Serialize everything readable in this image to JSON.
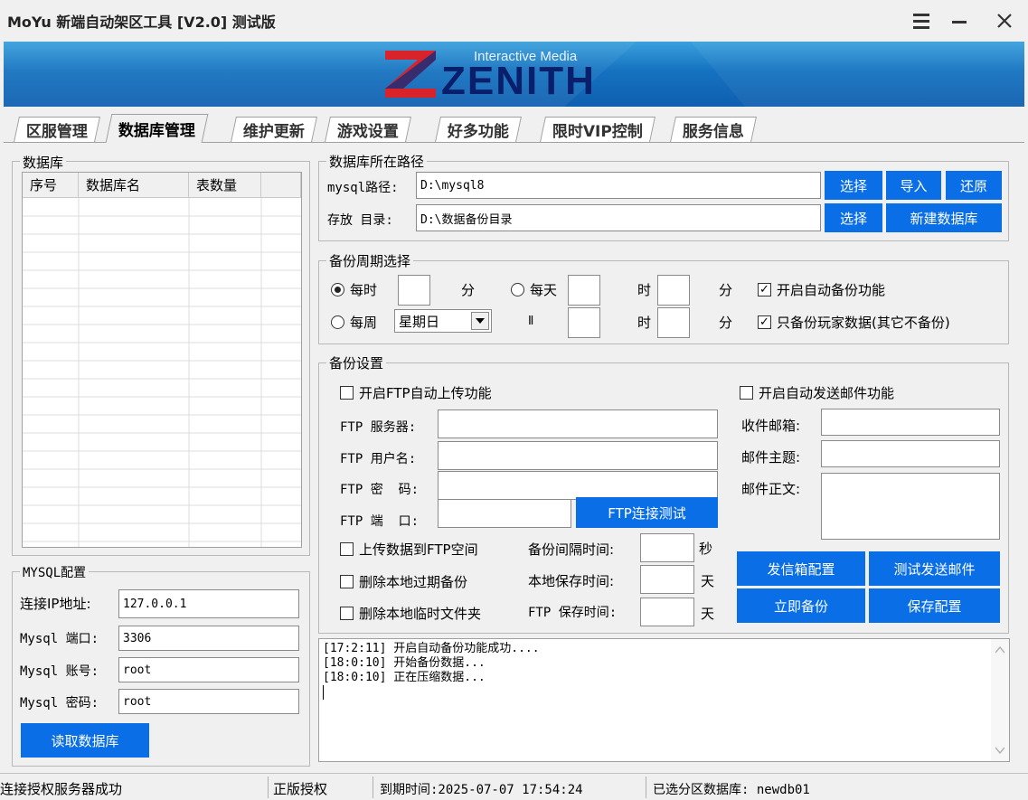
{
  "window": {
    "title": "MoYu 新端自动架区工具 [V2.0] 测试版"
  },
  "banner": {
    "brand": "ZENITH",
    "tagline": "Interactive Media"
  },
  "tabs": [
    "区服管理",
    "数据库管理",
    "维护更新",
    "游戏设置",
    "好多功能",
    "限时VIP控制",
    "服务信息"
  ],
  "active_tab": "数据库管理",
  "db_list": {
    "group_label": "数据库",
    "columns": [
      "序号",
      "数据库名",
      "表数量"
    ],
    "rows": []
  },
  "path": {
    "group_label": "数据库所在路径",
    "mysql_label": "mysql路径:",
    "mysql_value": "D:\\mysql8",
    "store_label": "存放 目录:",
    "store_value": "D:\\数据备份目录",
    "btn_select": "选择",
    "btn_import": "导入",
    "btn_restore": "还原",
    "btn_newdb": "新建数据库"
  },
  "period": {
    "group_label": "备份周期选择",
    "hourly": "每时",
    "min": "分",
    "daily": "每天",
    "hour": "时",
    "weekly": "每周",
    "weekday": "星期日",
    "sep": "Ⅱ",
    "auto_backup": "开启自动备份功能",
    "player_only": "只备份玩家数据(其它不备份)"
  },
  "backup": {
    "group_label": "备份设置",
    "ftp_enable": "开启FTP自动上传功能",
    "ftp_server": "FTP 服务器:",
    "ftp_user": "FTP 用户名:",
    "ftp_pass": "FTP 密  码:",
    "ftp_port": "FTP 端  口:",
    "ftp_test": "FTP连接测试",
    "upload": "上传数据到FTP空间",
    "interval": "备份间隔时间:",
    "sec": "秒",
    "del_expired": "删除本地过期备份",
    "local_keep": "本地保存时间:",
    "day": "天",
    "del_temp": "删除本地临时文件夹",
    "ftp_keep": "FTP 保存时间:",
    "mail_enable": "开启自动发送邮件功能",
    "mail_to": "收件邮箱:",
    "mail_subject": "邮件主题:",
    "mail_body": "邮件正文:",
    "btn_mailcfg": "发信箱配置",
    "btn_testmail": "测试发送邮件",
    "btn_backup_now": "立即备份",
    "btn_save": "保存配置"
  },
  "mysql": {
    "group_label": "MYSQL配置",
    "ip_label": "连接IP地址:",
    "ip": "127.0.0.1",
    "port_label": "Mysql 端口:",
    "port": "3306",
    "user_label": "Mysql 账号:",
    "user": "root",
    "pass_label": "Mysql 密码:",
    "pass": "root",
    "btn_read": "读取数据库"
  },
  "log": [
    "[17:2:11] 开启自动备份功能成功....",
    "[18:0:10] 开始备份数据...",
    "[18:0:10] 正在压缩数据..."
  ],
  "status": {
    "conn": "连接授权服务器成功",
    "license": "正版授权",
    "expire": "到期时间:2025-07-07 17:54:24",
    "selected": "已选分区数据库: newdb01"
  },
  "colors": {
    "accent": "#0a6ee6",
    "banner": "#1572c0",
    "brand_red": "#d8232a"
  }
}
